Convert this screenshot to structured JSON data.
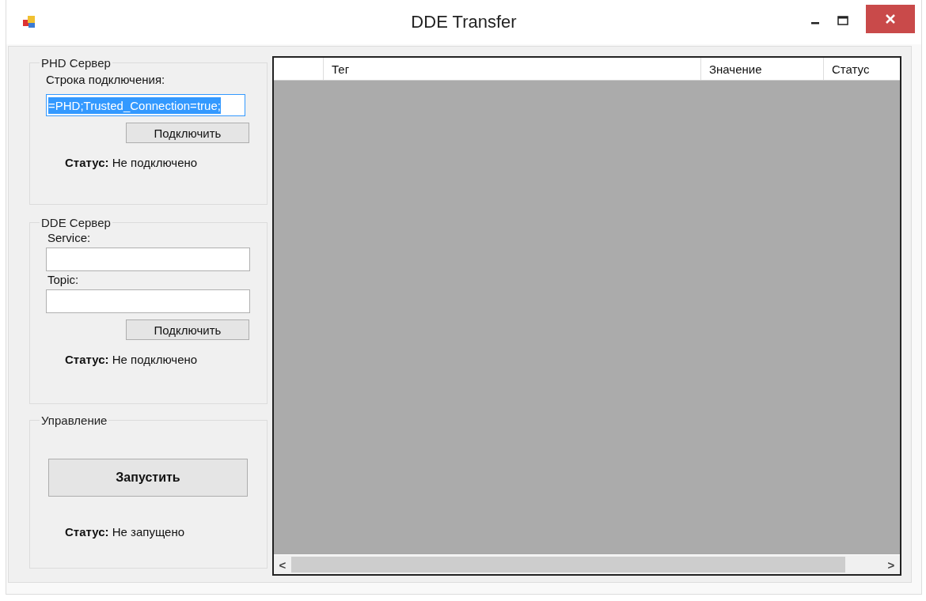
{
  "window": {
    "title": "DDE Transfer"
  },
  "phd_group": {
    "title": "PHD Сервер",
    "label": "Строка подключения:",
    "field": {
      "value": "=PHD;Trusted_Connection=true;",
      "text_selected": true
    },
    "button": "Подключить",
    "status": "**Статус:** Не подключено"
  },
  "dde_group": {
    "title": "DDE Сервер",
    "fields": [
      {
        "label": "Service:"
      },
      {
        "label": "Topic:"
      }
    ],
    "button": "Подключить",
    "status": "**Статус:** Не подключено"
  },
  "control_group": {
    "title": "Управление",
    "button": "Запустить",
    "status": "**Статус:** Не запущено"
  },
  "table": {
    "columns": [
      {
        "label": "Тег"
      },
      {
        "label": "Значение"
      },
      {
        "label": "Статус"
      }
    ],
    "scrollbar": {
      "left": "<",
      "right": ">"
    }
  }
}
